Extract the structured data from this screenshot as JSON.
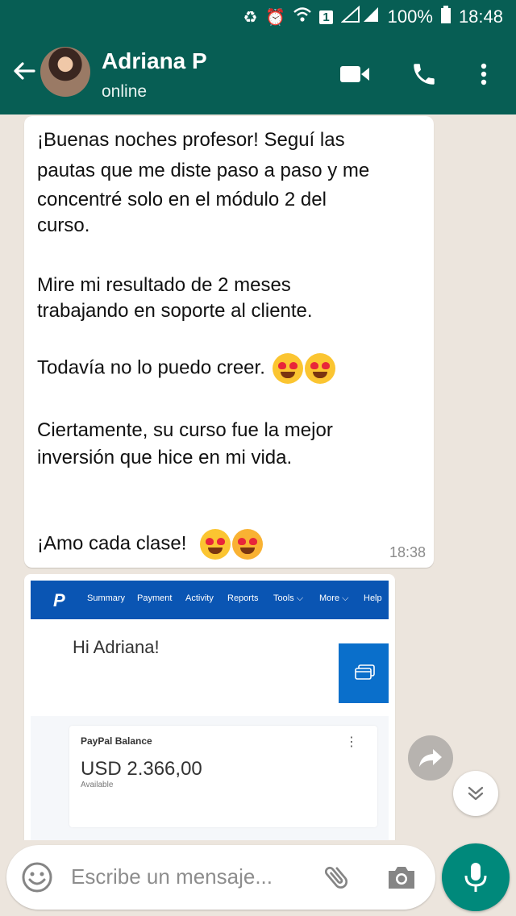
{
  "status_bar": {
    "battery": "100%",
    "time": "18:48",
    "sim_badge": "1"
  },
  "contact": {
    "name": "Adriana P",
    "status": "online"
  },
  "message": {
    "lines": [
      "¡Buenas noches profesor! Seguí las",
      "pautas que me diste paso a paso y me",
      "concentré solo en el módulo 2 del",
      "curso.",
      "Mire mi resultado de 2 meses",
      "trabajando en soporte al cliente.",
      "Todavía no lo puedo creer.",
      "Ciertamente, su curso fue la mejor",
      "inversión que hice en mi vida.",
      "¡Amo cada clase!"
    ],
    "time": "18:38"
  },
  "paypal": {
    "logo": "P",
    "nav": [
      "Summary",
      "Payment",
      "Activity",
      "Reports",
      "Tools ⌵",
      "More ⌵",
      "Help"
    ],
    "greeting": "Hi Adriana!",
    "card_title": "PayPal Balance",
    "amount": "USD 2.366,00",
    "amount_sub": "Available"
  },
  "composer": {
    "placeholder": "Escribe un mensaje..."
  },
  "colors": {
    "header": "#075e54",
    "accent": "#00897b",
    "chat_bg": "#ece5dd",
    "paypal_blue": "#0a55b3"
  }
}
